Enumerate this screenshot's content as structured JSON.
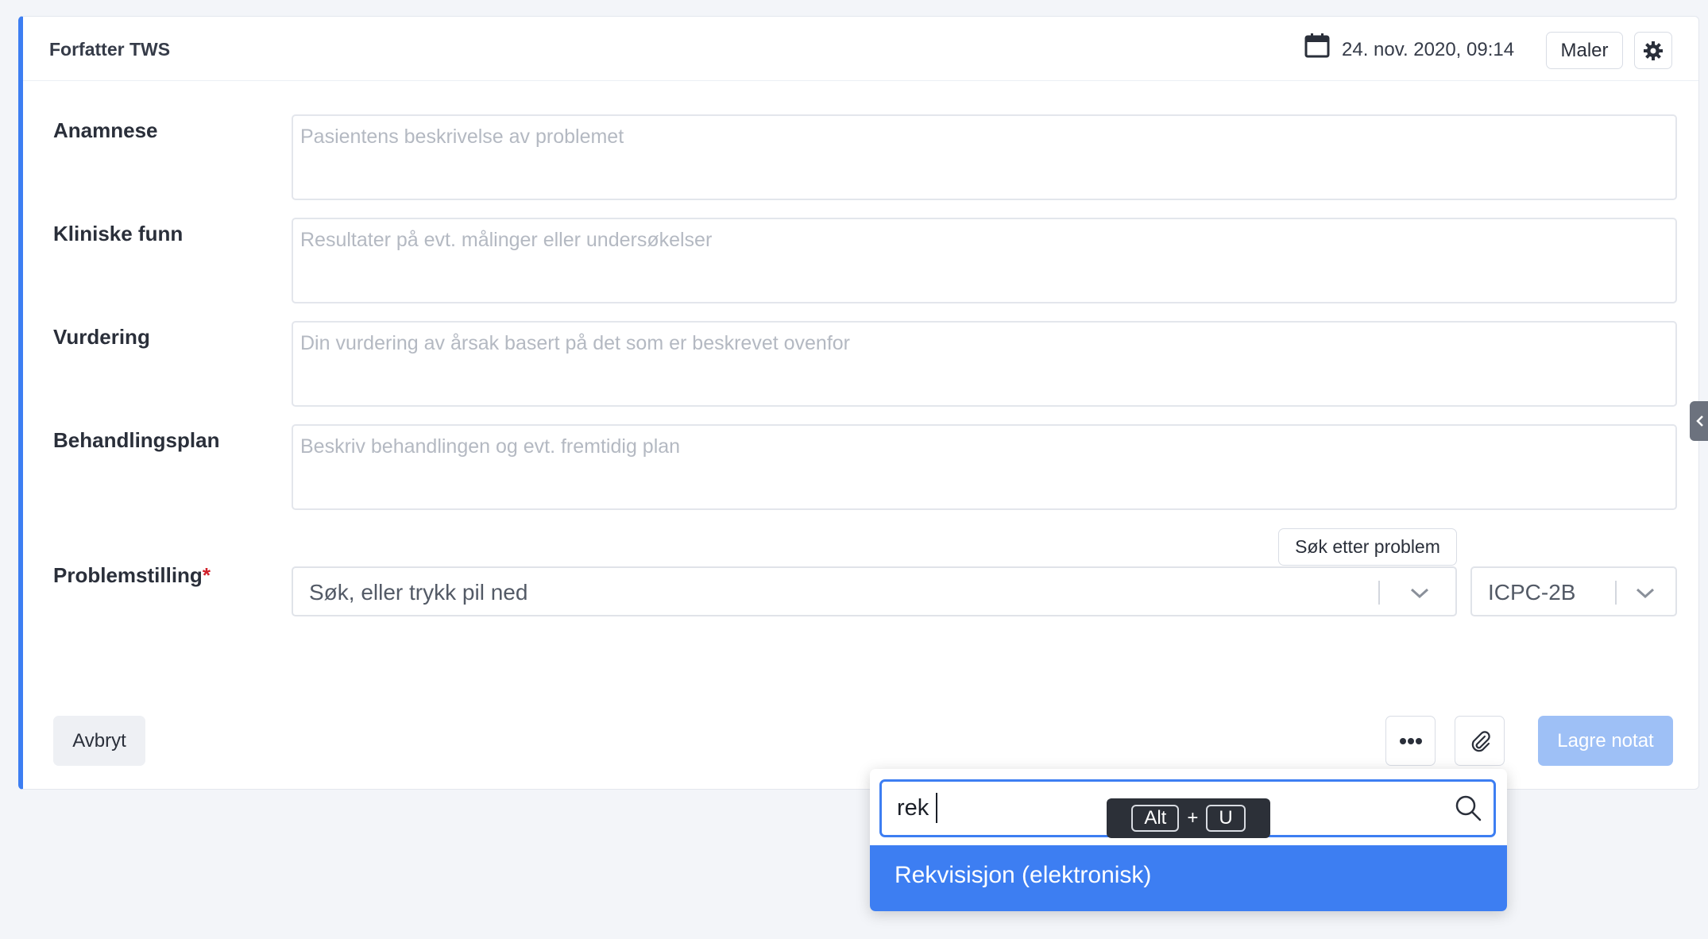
{
  "header": {
    "author": "Forfatter TWS",
    "date": "24. nov. 2020, 09:14",
    "templates_label": "Maler",
    "settings_icon": "gear-icon",
    "calendar_icon": "calendar-icon"
  },
  "fields": [
    {
      "label": "Anamnese",
      "placeholder": "Pasientens beskrivelse av problemet"
    },
    {
      "label": "Kliniske funn",
      "placeholder": "Resultater på evt. målinger eller undersøkelser"
    },
    {
      "label": "Vurdering",
      "placeholder": "Din vurdering av årsak basert på det som er beskrevet ovenfor"
    },
    {
      "label": "Behandlingsplan",
      "placeholder": "Beskriv behandlingen og evt. fremtidig plan"
    }
  ],
  "problem": {
    "label": "Problemstilling",
    "required_mark": "*",
    "search_tooltip": "Søk etter problem",
    "select_placeholder": "Søk, eller trykk pil ned",
    "code_system": "ICPC-2B"
  },
  "footer": {
    "cancel_label": "Avbryt",
    "more_icon": "ellipsis-icon",
    "attach_icon": "paperclip-icon",
    "save_label": "Lagre notat"
  },
  "popup": {
    "search_value": "rek",
    "result_label": "Rekvisisjon (elektronisk)",
    "shortcut": {
      "key1": "Alt",
      "plus": "+",
      "key2": "U"
    }
  },
  "colors": {
    "accent": "#3d7ef2",
    "save_disabled": "#9ec0f6",
    "required": "#d0202a"
  }
}
